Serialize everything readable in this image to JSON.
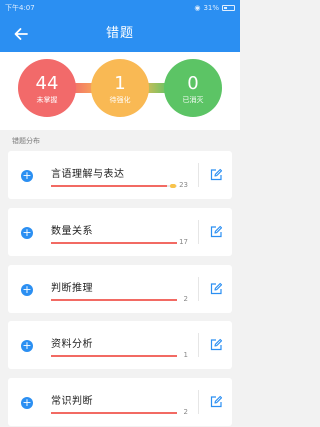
{
  "status_bar": {
    "time": "下午4:07",
    "battery": "31%"
  },
  "navbar": {
    "title": "错题"
  },
  "stats": [
    {
      "value": "44",
      "label": "未掌握",
      "color": "#f26a6a"
    },
    {
      "value": "1",
      "label": "待强化",
      "color": "#f9b954"
    },
    {
      "value": "0",
      "label": "已消灭",
      "color": "#5cc465"
    }
  ],
  "section_title": "错题分布",
  "categories": [
    {
      "name": "言语理解与表达",
      "count": "23",
      "progress": 0.92,
      "accent": true
    },
    {
      "name": "数量关系",
      "count": "17",
      "progress": 1.0,
      "accent": false
    },
    {
      "name": "判断推理",
      "count": "2",
      "progress": 1.0,
      "accent": false
    },
    {
      "name": "资料分析",
      "count": "1",
      "progress": 1.0,
      "accent": false
    },
    {
      "name": "常识判断",
      "count": "2",
      "progress": 1.0,
      "accent": false
    }
  ]
}
